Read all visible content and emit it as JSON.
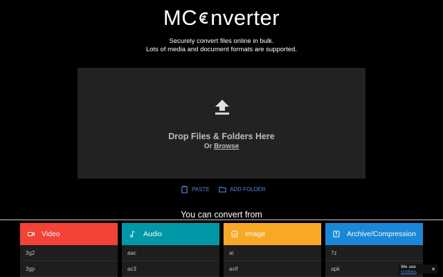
{
  "header": {
    "logo_prefix": "MC",
    "logo_suffix": "nverter",
    "tagline_line1": "Securely convert files online in bulk.",
    "tagline_line2": "Lots of media and document formats are supported."
  },
  "dropzone": {
    "icon": "upload-icon",
    "title": "Drop Files & Folders Here",
    "or_label": "Or",
    "browse_label": "Browse"
  },
  "actions": {
    "paste": {
      "label": "PASTE",
      "icon": "clipboard-icon"
    },
    "add_folder": {
      "label": "ADD FOLDER",
      "icon": "folder-icon"
    }
  },
  "convert_heading": "You can convert from",
  "categories": [
    {
      "name": "Video",
      "icon": "video-icon",
      "color": "#f44336",
      "formats": [
        "3g2",
        "3gp"
      ]
    },
    {
      "name": "Audio",
      "icon": "music-note-icon",
      "color": "#0097a7",
      "formats": [
        "aac",
        "ac3"
      ]
    },
    {
      "name": "Image",
      "icon": "image-icon",
      "color": "#f9a825",
      "formats": [
        "ai",
        "avif"
      ]
    },
    {
      "name": "Archive/Compression",
      "icon": "archive-icon",
      "color": "#1a88d8",
      "formats": [
        "7z",
        "apk"
      ]
    }
  ],
  "cookie_banner": {
    "prefix": "We use",
    "link": "cookies",
    "suffix": ".",
    "close": "✕"
  },
  "colors": {
    "background": "#000000",
    "dropzone": "#222222",
    "accent_link": "#4a86e8"
  }
}
